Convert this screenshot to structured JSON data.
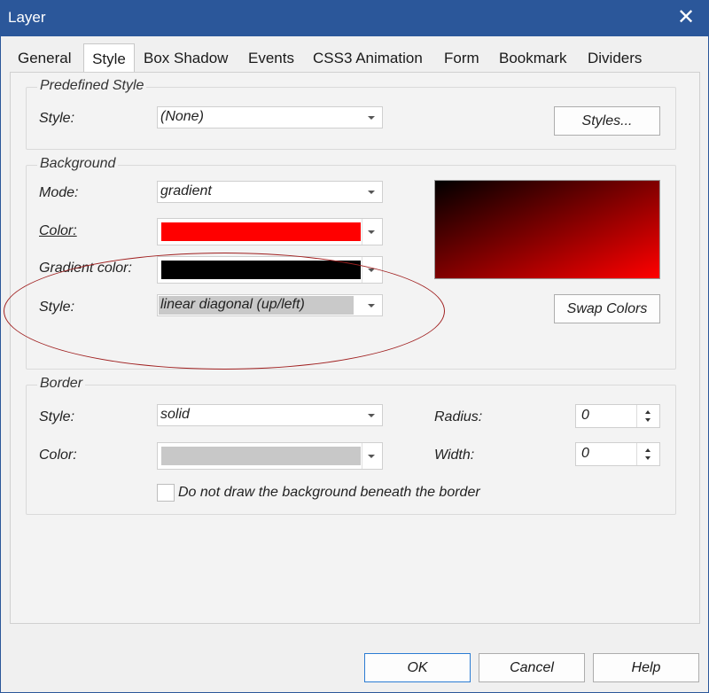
{
  "window": {
    "title": "Layer",
    "close_icon": "close-icon"
  },
  "tabs": [
    {
      "label": "General"
    },
    {
      "label": "Style",
      "active": true
    },
    {
      "label": "Box Shadow"
    },
    {
      "label": "Events"
    },
    {
      "label": "CSS3 Animation"
    },
    {
      "label": "Form"
    },
    {
      "label": "Bookmark"
    },
    {
      "label": "Dividers"
    }
  ],
  "predefined": {
    "title": "Predefined Style",
    "style_label": "Style:",
    "style_value": "(None)",
    "styles_button": "Styles..."
  },
  "background": {
    "title": "Background",
    "mode_label": "Mode:",
    "mode_value": "gradient",
    "color_label": "Color:",
    "color_hex": "#ff0000",
    "gradient_color_label": "Gradient color:",
    "gradient_color_hex": "#000000",
    "style_label": "Style:",
    "style_value": "linear diagonal (up/left)",
    "swap_button": "Swap Colors"
  },
  "border": {
    "title": "Border",
    "style_label": "Style:",
    "style_value": "solid",
    "color_label": "Color:",
    "color_hex": "#c8c8c8",
    "radius_label": "Radius:",
    "radius_value": "0",
    "width_label": "Width:",
    "width_value": "0",
    "checkbox_label": "Do not draw the background beneath the border",
    "checkbox_checked": false
  },
  "footer": {
    "ok": "OK",
    "cancel": "Cancel",
    "help": "Help"
  },
  "colors": {
    "accent": "#2b579a",
    "annotation": "#a02020"
  }
}
